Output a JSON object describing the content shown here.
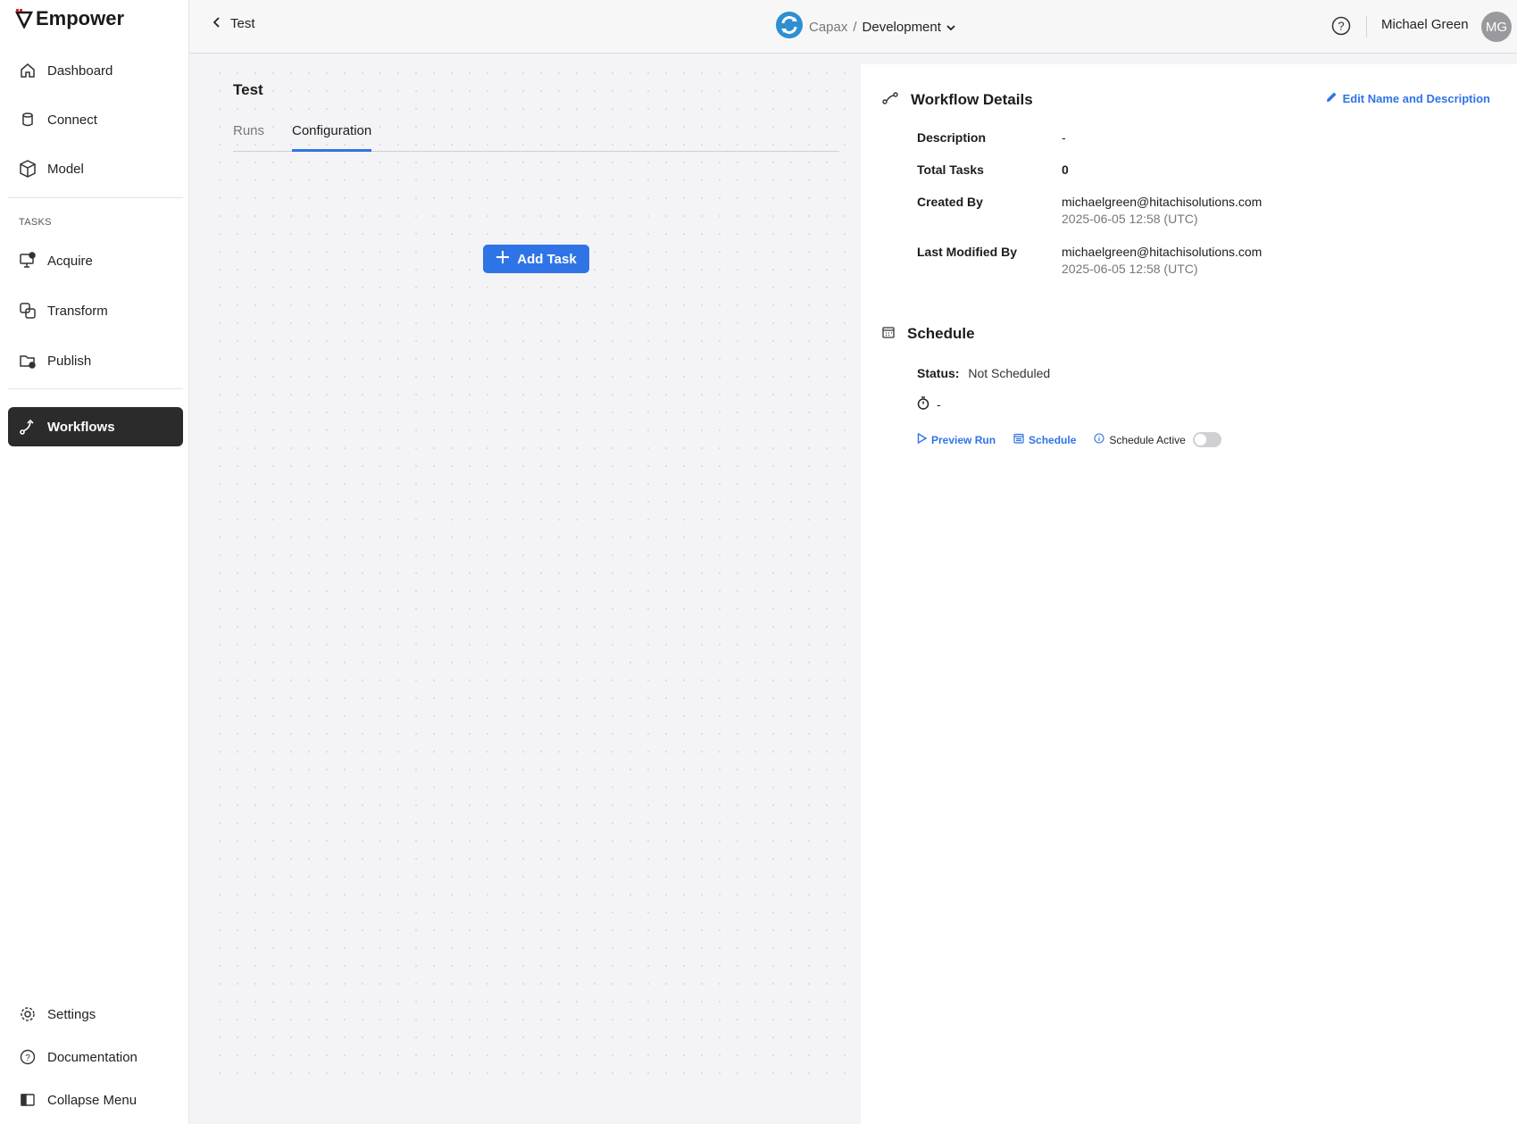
{
  "brand": {
    "name": "Empower"
  },
  "sidebar": {
    "items": [
      {
        "label": "Dashboard",
        "icon": "home-icon"
      },
      {
        "label": "Connect",
        "icon": "database-icon"
      },
      {
        "label": "Model",
        "icon": "cube-icon"
      }
    ],
    "tasks_label": "TASKS",
    "task_items": [
      {
        "label": "Acquire",
        "icon": "acquire-icon"
      },
      {
        "label": "Transform",
        "icon": "transform-icon"
      },
      {
        "label": "Publish",
        "icon": "publish-icon"
      }
    ],
    "active_item": {
      "label": "Workflows",
      "icon": "workflow-icon"
    },
    "footer_items": [
      {
        "label": "Settings",
        "icon": "gear-icon"
      },
      {
        "label": "Documentation",
        "icon": "help-circle-icon"
      },
      {
        "label": "Collapse Menu",
        "icon": "collapse-icon"
      }
    ]
  },
  "topbar": {
    "back_label": "Test",
    "org": "Capax",
    "separator": "/",
    "environment": "Development",
    "user_name": "Michael Green",
    "user_initials": "MG"
  },
  "workflow": {
    "title": "Test",
    "tabs": [
      {
        "label": "Runs",
        "active": false
      },
      {
        "label": "Configuration",
        "active": true
      }
    ],
    "add_task_label": "Add Task"
  },
  "details": {
    "heading": "Workflow Details",
    "edit_label": "Edit Name and Description",
    "description_label": "Description",
    "description_value": "-",
    "total_tasks_label": "Total Tasks",
    "total_tasks_value": "0",
    "created_by_label": "Created By",
    "created_by_email": "michaelgreen@hitachisolutions.com",
    "created_by_date": "2025-06-05 12:58 (UTC)",
    "modified_by_label": "Last Modified By",
    "modified_by_email": "michaelgreen@hitachisolutions.com",
    "modified_by_date": "2025-06-05 12:58 (UTC)"
  },
  "schedule": {
    "heading": "Schedule",
    "status_label": "Status:",
    "status_value": "Not Scheduled",
    "timer_value": "-",
    "preview_run_label": "Preview Run",
    "schedule_label": "Schedule",
    "schedule_active_label": "Schedule Active",
    "schedule_active": false
  },
  "colors": {
    "accent": "#2f74e6",
    "active_nav": "#2b2b2b",
    "logo_red": "#d9232e"
  }
}
